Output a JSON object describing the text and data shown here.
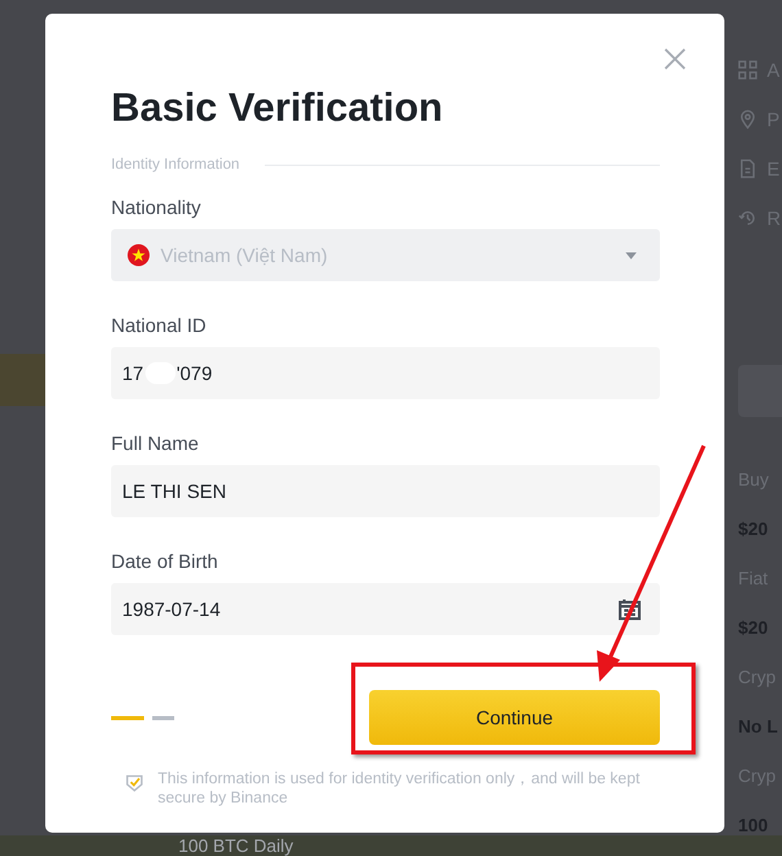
{
  "background": {
    "side_items": [
      {
        "kind": "grid",
        "label": "A"
      },
      {
        "kind": "pin",
        "label": "P"
      },
      {
        "kind": "doc",
        "label": "E"
      },
      {
        "kind": "history",
        "label": "R"
      }
    ],
    "limits": [
      {
        "label": "Buy",
        "value": "$20"
      },
      {
        "label": "Fiat",
        "value": "$20"
      },
      {
        "label": "Cryp",
        "value": "No L"
      },
      {
        "label": "Cryp",
        "value": "100"
      }
    ],
    "footer_text": "100 BTC Daily"
  },
  "dialog": {
    "title": "Basic Verification",
    "section": "Identity Information",
    "fields": [
      {
        "kind": "select",
        "label": "Nationality",
        "value": "Vietnam (Việt Nam)",
        "disabled": true
      },
      {
        "kind": "redacted",
        "label": "National ID",
        "value_start": "17",
        "value_end": "'079"
      },
      {
        "kind": "text",
        "label": "Full Name",
        "value": "LE THI SEN"
      },
      {
        "kind": "date",
        "label": "Date of Birth",
        "value": "1987-07-14"
      }
    ],
    "steps": [
      {
        "selected": true
      },
      {
        "selected": false
      }
    ],
    "button": "Continue",
    "note": "This information is used for identity verification only，and will be kept secure by Binance"
  }
}
